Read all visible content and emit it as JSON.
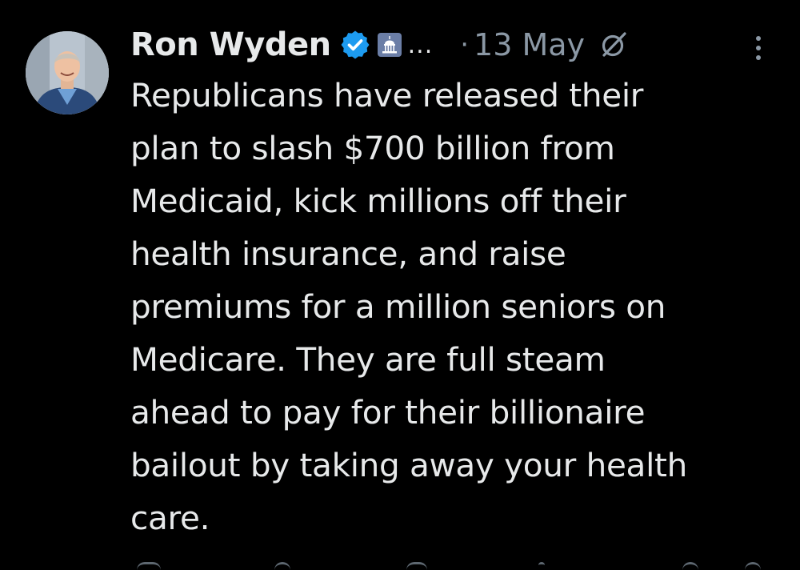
{
  "tweet": {
    "author_name": "Ron Wyden",
    "ellipsis": "...",
    "separator": "·",
    "date": "13 May",
    "lines": [
      "Republicans have released their",
      "plan to slash $700 billion from",
      "Medicaid, kick millions off their",
      "health insurance, and raise",
      "premiums for a million seniors on",
      "Medicare. They are full steam",
      "ahead to pay for their billionaire",
      "bailout by taking away your health",
      "care."
    ],
    "icons": {
      "verified": "verified-badge-icon",
      "government": "capitol-building-icon",
      "grok": "grok-icon",
      "more": "more-vertical-icon"
    }
  },
  "colors": {
    "background": "#000000",
    "text": "#e7e9ea",
    "muted": "#8b98a5",
    "verified_blue": "#1d9bf0",
    "gov_badge": "#6b7ea6"
  }
}
